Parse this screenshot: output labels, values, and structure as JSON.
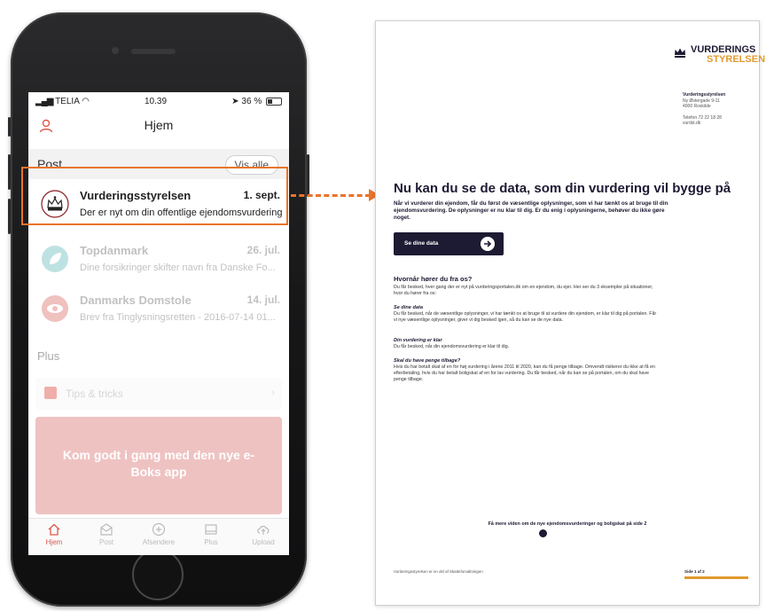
{
  "colors": {
    "accent_orange": "#e8742a",
    "app_red": "#e0574a",
    "navy": "#1d1a33",
    "gold": "#e29a2d"
  },
  "status_bar": {
    "carrier": "TELIA",
    "time": "10.39",
    "battery": "36 %"
  },
  "nav": {
    "title": "Hjem",
    "user_icon": "user-icon"
  },
  "post_section": {
    "label": "Post",
    "vis_alle": "Vis alle"
  },
  "messages": [
    {
      "sender": "Vurderingsstyrelsen",
      "date": "1. sept.",
      "snippet": "Der er nyt om din offentlige ejendomsvurdering",
      "icon": "crown-logo-icon"
    },
    {
      "sender": "Topdanmark",
      "date": "26. jul.",
      "snippet": "Dine forsikringer skifter navn fra Danske Fo...",
      "icon": "leaf-logo-icon"
    },
    {
      "sender": "Danmarks Domstole",
      "date": "14. jul.",
      "snippet": "Brev fra Tinglysningsretten - 2016-07-14 01...",
      "icon": "eye-logo-icon"
    }
  ],
  "plus_section": {
    "label": "Plus",
    "tips": "Tips & tricks",
    "promo": "Kom godt i gang med den nye e-Boks app"
  },
  "tabs": [
    {
      "label": "Hjem",
      "icon": "home-icon",
      "active": true
    },
    {
      "label": "Post",
      "icon": "mail-icon",
      "active": false
    },
    {
      "label": "Afsendere",
      "icon": "plus-circle-icon",
      "active": false
    },
    {
      "label": "Plus",
      "icon": "tray-icon",
      "active": false
    },
    {
      "label": "Upload",
      "icon": "cloud-upload-icon",
      "active": false
    }
  ],
  "letter": {
    "logo_line1": "VURDERINGS",
    "logo_line2": "STYRELSEN",
    "address_name": "Vurderingsstyrelsen",
    "address_street": "Ny Østergade 9-11",
    "address_city": "4000 Roskilde",
    "address_phone": "Telefon 72 22 18 28",
    "address_web": "vurdst.dk",
    "headline": "Nu kan du se de data, som din vurdering vil bygge på",
    "lead": "Når vi vurderer din ejendom, får du først de væsentlige oplysninger, som vi har tænkt os at bruge til din ejendomsvurdering. De oplysninger er nu klar til dig. Er du enig i oplysningerne, behøver du ikke gøre noget.",
    "cta": "Se dine data",
    "section_title": "Hvornår hører du fra os?",
    "section_body": "Du får besked, hver gang der er nyt på vurderingsportalen.dk om en ejendom, du ejer. Her ser du 3 eksempler på situationer, hvor du hører fra os:",
    "sub1_title": "Se dine data",
    "sub1_body": "Du får besked, når de væsentlige oplysninger, vi har tænkt os at bruge til at vurdere din ejendom, er klar til dig på portalen. Får vi nye væsentlige oplysninger, giver vi dig besked igen, så du kan se de nye data.",
    "sub2_title": "Din vurdering er klar",
    "sub2_body": "Du får besked, når din ejendomsvurdering er klar til dig.",
    "sub3_title": "Skal du have penge tilbage?",
    "sub3_body": "Hvis du har betalt skat af en for høj vurdering i årene 2011 til 2020, kan du få penge tilbage. Omvendt risikerer du ikke at få en efterbetaling, hvis du har betalt boligskat af en for lav vurdering. Du får besked, når du kan se på portalen, om du skal have penge tilbage.",
    "footer_link": "Få mere viden om de nye ejendomsvurderinger og boligskat på side 2",
    "footer_left": "Vurderingsstyrelsen er en del af Skatteforvaltningen",
    "footer_right": "Side 1 af 2"
  }
}
